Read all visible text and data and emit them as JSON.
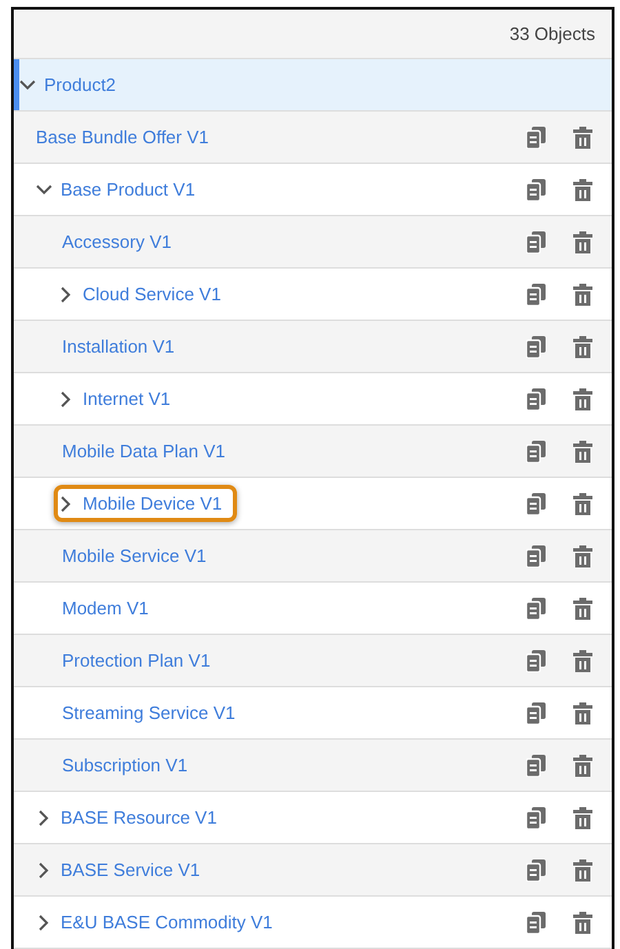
{
  "header": {
    "count": "33 Objects"
  },
  "tree": [
    {
      "label": "Product2",
      "expanded": true,
      "selected": true,
      "highlighted": false,
      "children": [
        {
          "label": "Base Bundle Offer V1",
          "selected": false,
          "highlighted": false
        },
        {
          "label": "Base Product V1",
          "expanded": true,
          "selected": false,
          "highlighted": false,
          "children": [
            {
              "label": "Accessory V1",
              "selected": false,
              "highlighted": false
            },
            {
              "label": "Cloud Service V1",
              "expanded": false,
              "selected": false,
              "highlighted": false
            },
            {
              "label": "Installation V1",
              "selected": false,
              "highlighted": false
            },
            {
              "label": "Internet V1",
              "expanded": false,
              "selected": false,
              "highlighted": false
            },
            {
              "label": "Mobile Data Plan V1",
              "selected": false,
              "highlighted": false
            },
            {
              "label": "Mobile Device V1",
              "expanded": false,
              "selected": false,
              "highlighted": true
            },
            {
              "label": "Mobile Service V1",
              "selected": false,
              "highlighted": false
            },
            {
              "label": "Modem V1",
              "selected": false,
              "highlighted": false
            },
            {
              "label": "Protection Plan V1",
              "selected": false,
              "highlighted": false
            },
            {
              "label": "Streaming Service V1",
              "selected": false,
              "highlighted": false
            },
            {
              "label": "Subscription V1",
              "selected": false,
              "highlighted": false
            }
          ]
        },
        {
          "label": "BASE Resource V1",
          "expanded": false,
          "selected": false,
          "highlighted": false
        },
        {
          "label": "BASE Service V1",
          "expanded": false,
          "selected": false,
          "highlighted": false
        },
        {
          "label": "E&U BASE Commodity V1",
          "expanded": false,
          "selected": false,
          "highlighted": false
        }
      ]
    }
  ]
}
